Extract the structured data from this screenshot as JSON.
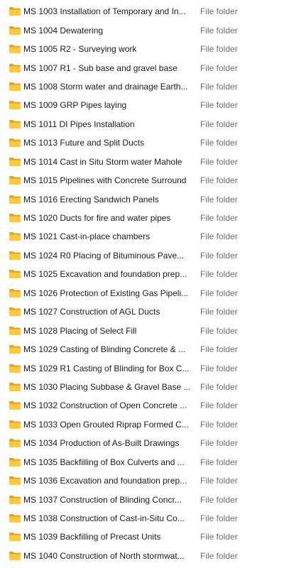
{
  "icons": {
    "folder": "folder-icon",
    "folder_color": "#FFC83D",
    "folder_back_color": "#E8A317"
  },
  "files": [
    {
      "name": "MS 1003 Installation of Temporary and In...",
      "type": "File folder"
    },
    {
      "name": "MS 1004 Dewatering",
      "type": "File folder"
    },
    {
      "name": "MS 1005 R2 - Surveying work",
      "type": "File folder"
    },
    {
      "name": "MS 1007 R1 - Sub base and gravel base",
      "type": "File folder"
    },
    {
      "name": "MS 1008 Storm water and drainage Earth...",
      "type": "File folder"
    },
    {
      "name": "MS 1009 GRP Pipes laying",
      "type": "File folder"
    },
    {
      "name": "MS 1011 DI Pipes Installation",
      "type": "File folder"
    },
    {
      "name": "MS 1013 Future and Split Ducts",
      "type": "File folder"
    },
    {
      "name": "MS 1014 Cast in Situ Storm water Mahole",
      "type": "File folder"
    },
    {
      "name": "MS 1015 Pipelines with Concrete Surround",
      "type": "File folder"
    },
    {
      "name": "MS 1016 Erecting Sandwich Panels",
      "type": "File folder"
    },
    {
      "name": "MS 1020 Ducts for fire and water pipes",
      "type": "File folder"
    },
    {
      "name": "MS 1021 Cast-in-place chambers",
      "type": "File folder"
    },
    {
      "name": "MS 1024 R0 Placing of Bituminous Pave...",
      "type": "File folder"
    },
    {
      "name": "MS 1025 Excavation and foundation prep...",
      "type": "File folder"
    },
    {
      "name": "MS 1026 Protection of Existing Gas Pipeli...",
      "type": "File folder"
    },
    {
      "name": "MS 1027 Construction of AGL Ducts",
      "type": "File folder"
    },
    {
      "name": "MS 1028 Placing of Select Fill",
      "type": "File folder"
    },
    {
      "name": "MS 1029 Casting of Blinding Concrete & ...",
      "type": "File folder"
    },
    {
      "name": "MS 1029 R1 Casting of Blinding for Box C...",
      "type": "File folder"
    },
    {
      "name": "MS 1030 Placing Subbase & Gravel Base ...",
      "type": "File folder"
    },
    {
      "name": "MS 1032 Construction of Open Concrete ...",
      "type": "File folder"
    },
    {
      "name": "MS 1033 Open Grouted Riprap Formed C...",
      "type": "File folder"
    },
    {
      "name": "MS 1034 Production of As-Built Drawings",
      "type": "File folder"
    },
    {
      "name": "MS 1035 Backfilling of Box Culverts and ...",
      "type": "File folder"
    },
    {
      "name": "MS 1036 Excavation and foundation prep...",
      "type": "File folder"
    },
    {
      "name": "MS 1037 Construction of Blinding Concr...",
      "type": "File folder"
    },
    {
      "name": "MS 1038 Construction of Cast-in-Situ Co...",
      "type": "File folder"
    },
    {
      "name": "MS 1039 Backfilling of Precast Units",
      "type": "File folder"
    },
    {
      "name": "MS 1040 Construction of North stormwat...",
      "type": "File folder"
    }
  ]
}
